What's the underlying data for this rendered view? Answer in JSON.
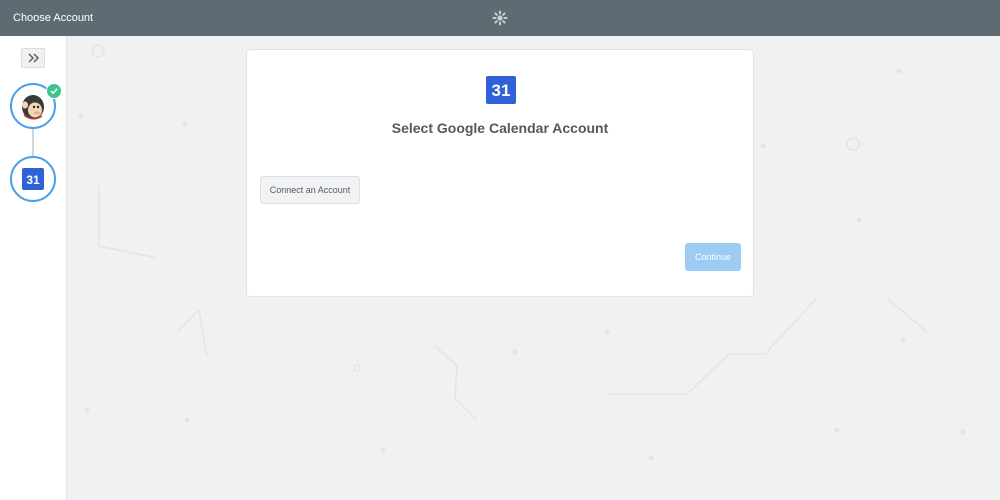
{
  "topbar": {
    "title": "Choose Account",
    "logo_icon": "spinner-gear-icon"
  },
  "sidebar": {
    "expand_icon": "double-chevron-right-icon",
    "steps": [
      {
        "app": "Mailchimp",
        "icon": "mailchimp-monkey-icon",
        "completed": true
      },
      {
        "app": "Google Calendar",
        "icon": "google-calendar-icon",
        "number": "31",
        "completed": false
      }
    ]
  },
  "card": {
    "icon_number": "31",
    "title": "Select Google Calendar Account",
    "connect_label": "Connect an Account",
    "continue_label": "Continue"
  },
  "colors": {
    "topbar": "#5f6b73",
    "step_ring": "#4a9fe8",
    "check": "#3ec48a",
    "calendar_blue": "#2f62d6",
    "continue_disabled": "#9ccbf3"
  }
}
